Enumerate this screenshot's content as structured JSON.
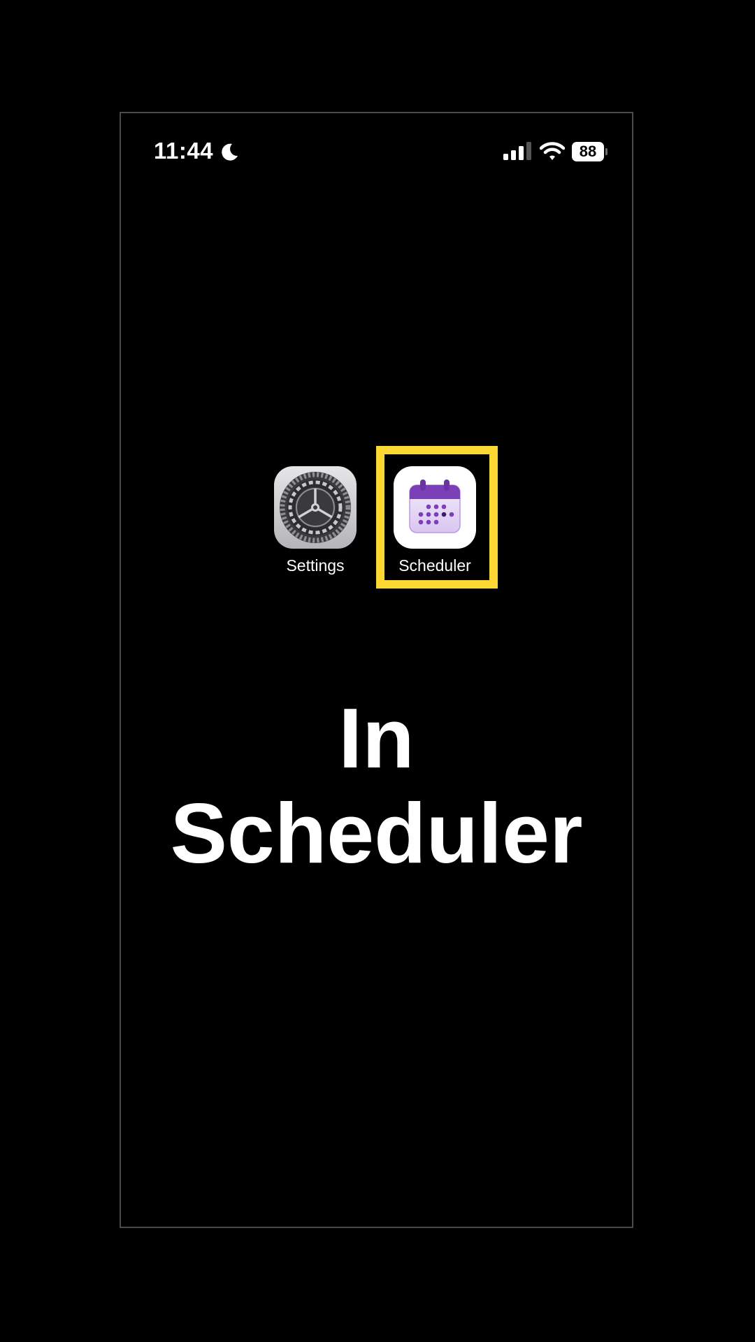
{
  "status_bar": {
    "time": "11:44",
    "battery_level": "88",
    "icons": [
      "moon-icon",
      "signal-icon",
      "wifi-icon",
      "battery-icon"
    ]
  },
  "apps": [
    {
      "label": "Settings",
      "icon": "gear-icon"
    },
    {
      "label": "Scheduler",
      "icon": "calendar-icon"
    }
  ],
  "highlight": {
    "target": "Scheduler",
    "color": "#fdd835"
  },
  "caption": {
    "line1": "In",
    "line2": "Scheduler"
  },
  "colors": {
    "background": "#000000",
    "text": "#ffffff",
    "highlight": "#fdd835",
    "scheduler_purple": "#7b3fb8"
  }
}
